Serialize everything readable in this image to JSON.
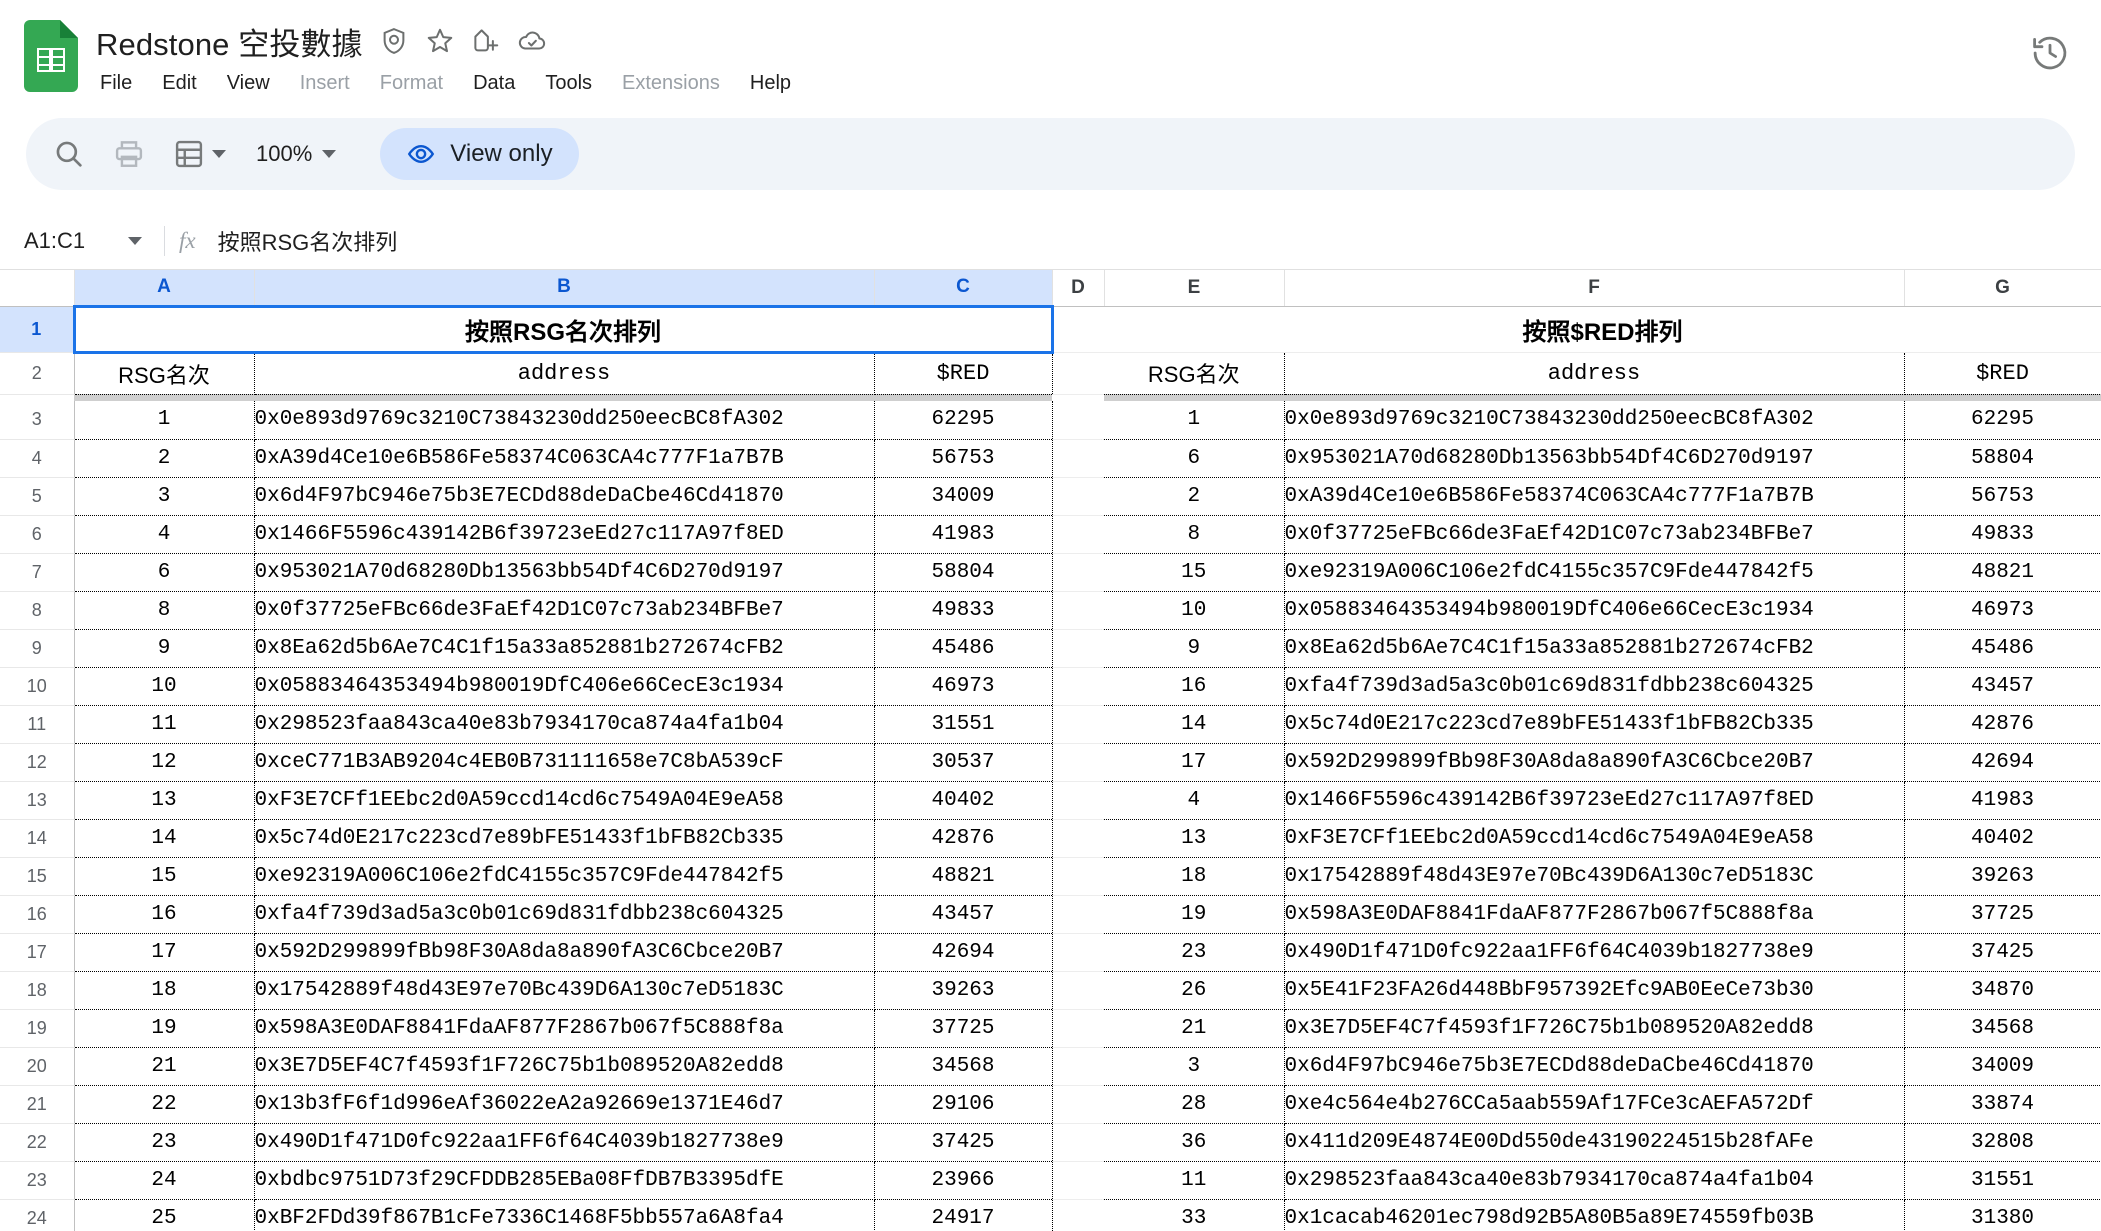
{
  "app": {
    "logo_name": "google-sheets-logo",
    "doc_title": "Redstone 空投數據",
    "title_icons": [
      "shield-check-icon",
      "star-icon",
      "move-to-folder-icon",
      "cloud-saved-icon"
    ],
    "history_icon": "version-history-icon"
  },
  "menus": [
    {
      "label": "File",
      "dim": false
    },
    {
      "label": "Edit",
      "dim": false
    },
    {
      "label": "View",
      "dim": false
    },
    {
      "label": "Insert",
      "dim": true
    },
    {
      "label": "Format",
      "dim": true
    },
    {
      "label": "Data",
      "dim": false
    },
    {
      "label": "Tools",
      "dim": false
    },
    {
      "label": "Extensions",
      "dim": true
    },
    {
      "label": "Help",
      "dim": false
    }
  ],
  "toolbar": {
    "search_icon": "search-icon",
    "print_icon": "print-icon",
    "sheet_icon": "sheet-view-icon",
    "zoom_value": "100%",
    "view_only_label": "View only",
    "view_only_icon": "eye-icon"
  },
  "formula_bar": {
    "name_box": "A1:C1",
    "fx_label": "fx",
    "formula_value": "按照RSG名次排列"
  },
  "grid": {
    "columns": [
      "A",
      "B",
      "C",
      "D",
      "E",
      "F",
      "G"
    ],
    "selected_columns": [
      "A",
      "B",
      "C"
    ],
    "row_numbers": [
      "1",
      "2",
      "3",
      "4",
      "5",
      "6",
      "7",
      "8",
      "9",
      "10",
      "11",
      "12",
      "13",
      "14",
      "15",
      "16",
      "17",
      "18",
      "19",
      "20",
      "21",
      "22",
      "23",
      "24"
    ],
    "selected_rows": [
      "1"
    ]
  },
  "table_left": {
    "title": "按照RSG名次排列",
    "headers": {
      "rank": "RSG名次",
      "address": "address",
      "red": "$RED"
    },
    "rows": [
      {
        "rank": "1",
        "address": "0x0e893d9769c3210C73843230dd250eecBC8fA302",
        "red": "62295"
      },
      {
        "rank": "2",
        "address": "0xA39d4Ce10e6B586Fe58374C063CA4c777F1a7B7B",
        "red": "56753"
      },
      {
        "rank": "3",
        "address": "0x6d4F97bC946e75b3E7ECDd88deDaCbe46Cd41870",
        "red": "34009"
      },
      {
        "rank": "4",
        "address": "0x1466F5596c439142B6f39723eEd27c117A97f8ED",
        "red": "41983"
      },
      {
        "rank": "6",
        "address": "0x953021A70d68280Db13563bb54Df4C6D270d9197",
        "red": "58804"
      },
      {
        "rank": "8",
        "address": "0x0f37725eFBc66de3FaEf42D1C07c73ab234BFBe7",
        "red": "49833"
      },
      {
        "rank": "9",
        "address": "0x8Ea62d5b6Ae7C4C1f15a33a852881b272674cFB2",
        "red": "45486"
      },
      {
        "rank": "10",
        "address": "0x05883464353494b980019DfC406e66CecE3c1934",
        "red": "46973"
      },
      {
        "rank": "11",
        "address": "0x298523faa843ca40e83b7934170ca874a4fa1b04",
        "red": "31551"
      },
      {
        "rank": "12",
        "address": "0xceC771B3AB9204c4EB0B731111658e7C8bA539cF",
        "red": "30537"
      },
      {
        "rank": "13",
        "address": "0xF3E7CFf1EEbc2d0A59ccd14cd6c7549A04E9eA58",
        "red": "40402"
      },
      {
        "rank": "14",
        "address": "0x5c74d0E217c223cd7e89bFE51433f1bFB82Cb335",
        "red": "42876"
      },
      {
        "rank": "15",
        "address": "0xe92319A006C106e2fdC4155c357C9Fde447842f5",
        "red": "48821"
      },
      {
        "rank": "16",
        "address": "0xfa4f739d3ad5a3c0b01c69d831fdbb238c604325",
        "red": "43457"
      },
      {
        "rank": "17",
        "address": "0x592D299899fBb98F30A8da8a890fA3C6Cbce20B7",
        "red": "42694"
      },
      {
        "rank": "18",
        "address": "0x17542889f48d43E97e70Bc439D6A130c7eD5183C",
        "red": "39263"
      },
      {
        "rank": "19",
        "address": "0x598A3E0DAF8841FdaAF877F2867b067f5C888f8a",
        "red": "37725"
      },
      {
        "rank": "21",
        "address": "0x3E7D5EF4C7f4593f1F726C75b1b089520A82edd8",
        "red": "34568"
      },
      {
        "rank": "22",
        "address": "0x13b3fF6f1d996eAf36022eA2a92669e1371E46d7",
        "red": "29106"
      },
      {
        "rank": "23",
        "address": "0x490D1f471D0fc922aa1FF6f64C4039b1827738e9",
        "red": "37425"
      },
      {
        "rank": "24",
        "address": "0xbdbc9751D73f29CFDDB285EBa08FfDB7B3395dfE",
        "red": "23966"
      },
      {
        "rank": "25",
        "address": "0xBF2FDd39f867B1cFe7336C1468F5bb557a6A8fa4",
        "red": "24917"
      }
    ]
  },
  "table_right": {
    "title": "按照$RED排列",
    "headers": {
      "rank": "RSG名次",
      "address": "address",
      "red": "$RED"
    },
    "rows": [
      {
        "rank": "1",
        "address": "0x0e893d9769c3210C73843230dd250eecBC8fA302",
        "red": "62295"
      },
      {
        "rank": "6",
        "address": "0x953021A70d68280Db13563bb54Df4C6D270d9197",
        "red": "58804"
      },
      {
        "rank": "2",
        "address": "0xA39d4Ce10e6B586Fe58374C063CA4c777F1a7B7B",
        "red": "56753"
      },
      {
        "rank": "8",
        "address": "0x0f37725eFBc66de3FaEf42D1C07c73ab234BFBe7",
        "red": "49833"
      },
      {
        "rank": "15",
        "address": "0xe92319A006C106e2fdC4155c357C9Fde447842f5",
        "red": "48821"
      },
      {
        "rank": "10",
        "address": "0x05883464353494b980019DfC406e66CecE3c1934",
        "red": "46973"
      },
      {
        "rank": "9",
        "address": "0x8Ea62d5b6Ae7C4C1f15a33a852881b272674cFB2",
        "red": "45486"
      },
      {
        "rank": "16",
        "address": "0xfa4f739d3ad5a3c0b01c69d831fdbb238c604325",
        "red": "43457"
      },
      {
        "rank": "14",
        "address": "0x5c74d0E217c223cd7e89bFE51433f1bFB82Cb335",
        "red": "42876"
      },
      {
        "rank": "17",
        "address": "0x592D299899fBb98F30A8da8a890fA3C6Cbce20B7",
        "red": "42694"
      },
      {
        "rank": "4",
        "address": "0x1466F5596c439142B6f39723eEd27c117A97f8ED",
        "red": "41983"
      },
      {
        "rank": "13",
        "address": "0xF3E7CFf1EEbc2d0A59ccd14cd6c7549A04E9eA58",
        "red": "40402"
      },
      {
        "rank": "18",
        "address": "0x17542889f48d43E97e70Bc439D6A130c7eD5183C",
        "red": "39263"
      },
      {
        "rank": "19",
        "address": "0x598A3E0DAF8841FdaAF877F2867b067f5C888f8a",
        "red": "37725"
      },
      {
        "rank": "23",
        "address": "0x490D1f471D0fc922aa1FF6f64C4039b1827738e9",
        "red": "37425"
      },
      {
        "rank": "26",
        "address": "0x5E41F23FA26d448BbF957392Efc9AB0EeCe73b30",
        "red": "34870"
      },
      {
        "rank": "21",
        "address": "0x3E7D5EF4C7f4593f1F726C75b1b089520A82edd8",
        "red": "34568"
      },
      {
        "rank": "3",
        "address": "0x6d4F97bC946e75b3E7ECDd88deDaCbe46Cd41870",
        "red": "34009"
      },
      {
        "rank": "28",
        "address": "0xe4c564e4b276CCa5aab559Af17FCe3cAEFA572Df",
        "red": "33874"
      },
      {
        "rank": "36",
        "address": "0x411d209E4874E00Dd550de43190224515b28fAFe",
        "red": "32808"
      },
      {
        "rank": "11",
        "address": "0x298523faa843ca40e83b7934170ca874a4fa1b04",
        "red": "31551"
      },
      {
        "rank": "33",
        "address": "0x1cacab46201ec798d92B5A80B5a89E74559fb03B",
        "red": "31380"
      }
    ]
  },
  "colors": {
    "accent": "#1a73e8",
    "header_selected_bg": "#d3e3fd",
    "sheets_green": "#34a853",
    "toolbar_bg": "#f0f4f9"
  }
}
